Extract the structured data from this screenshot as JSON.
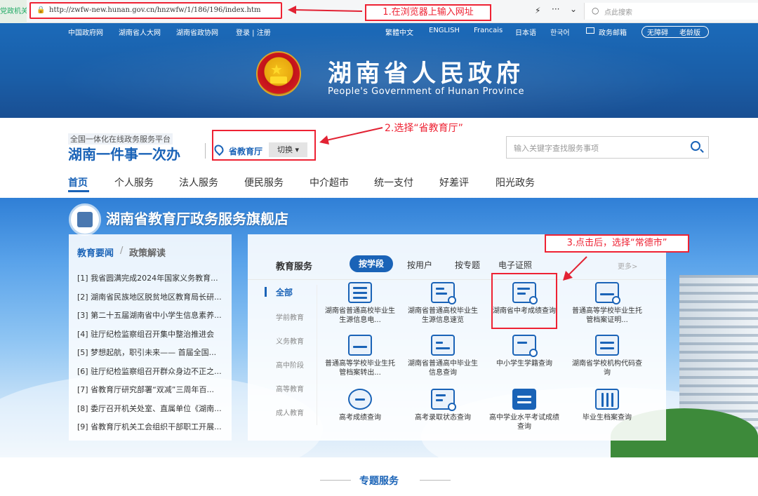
{
  "browser": {
    "tab_stub": "党政机关",
    "url": "http://zwfw-new.hunan.gov.cn/hnzwfw/1/186/196/index.htm",
    "search_placeholder": "点此搜索",
    "bolt": "⚡",
    "more": "···",
    "chevron": "⌄"
  },
  "annotations": {
    "step1": "1.在浏览器上输入网址",
    "step2": "2.选择“省教育厅”",
    "step3": "3.点击后，选择“常德市”",
    "color": "#e22233"
  },
  "header": {
    "links_left": [
      "中国政府网",
      "湖南省人大网",
      "湖南省政协网",
      "登录 | 注册"
    ],
    "links_right": [
      "繁體中文",
      "ENGLISH",
      "Francais",
      "日本语",
      "한국어"
    ],
    "mail": "政务邮箱",
    "access": [
      "无障碍",
      "老龄版"
    ],
    "title": "湖南省人民政府",
    "subtitle": "People's Government of Hunan Province",
    "emblem_star": "★"
  },
  "platform": {
    "small": "全国一体化在线政务服务平台",
    "title": "湖南一件事一次办",
    "location": "省教育厅",
    "switch": "切换 ▾",
    "search_placeholder": "输入关键字查找服务事项"
  },
  "nav": [
    "首页",
    "个人服务",
    "法人服务",
    "便民服务",
    "中介超市",
    "统一支付",
    "好差评",
    "阳光政务"
  ],
  "store": {
    "title": "湖南省教育厅政务服务旗舰店"
  },
  "news": {
    "tab1": "教育要闻",
    "slash": "/",
    "tab2": "政策解读",
    "items": [
      "[1]  我省圆满完成2024年国家义务教育...",
      "[2]  湖南省民族地区脱贫地区教育局长研...",
      "[3]  第二十五届湖南省中小学生信息素养...",
      "[4]  驻厅纪检监察组召开集中整治推进会",
      "[5]  梦想起航，职引未来—— 首届全国...",
      "[6]  驻厅纪检监察组召开群众身边不正之...",
      "[7]  省教育厅研究部署“双减”三周年百...",
      "[8]  委厅召开机关处室、直属单位《湖南...",
      "[9]  省教育厅机关工会组织干部职工开展..."
    ]
  },
  "services": {
    "title": "教育服务",
    "tabs": [
      "按学段",
      "按用户",
      "按专题",
      "电子证照"
    ],
    "more": "更多>",
    "categories": [
      "全部",
      "学前教育",
      "义务教育",
      "高中阶段",
      "高等教育",
      "成人教育"
    ],
    "items": [
      "湖南省普通高校毕业生生源信息电...",
      "湖南省普通高校毕业生生源信息速览",
      "湖南省中考成绩查询",
      "普通高等学校毕业生托管档案证明...",
      "普通高等学校毕业生托管档案转出...",
      "湖南省普通高中毕业生信息查询",
      "中小学生学籍查询",
      "湖南省学校机构代码查询",
      "高考成绩查询",
      "高考录取状态查询",
      "高中学业水平考试成绩查询",
      "毕业生档案查询"
    ],
    "accent": "#1a63b7"
  },
  "bottom": {
    "title": "专题服务"
  }
}
